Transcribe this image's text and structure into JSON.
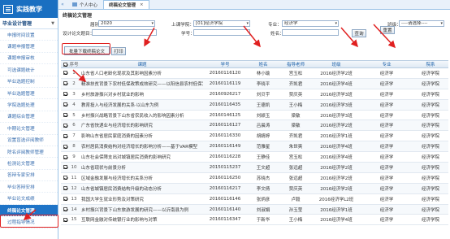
{
  "sidebar": {
    "logo": "实践教学",
    "section": "毕业设计管理",
    "items": [
      {
        "label": "申报时间设置"
      },
      {
        "label": "课题申报管理"
      },
      {
        "label": "课题申报审核"
      },
      {
        "label": "可选课题统计"
      },
      {
        "label": "毕业选题控制"
      },
      {
        "label": "毕业选题管理"
      },
      {
        "label": "学院选题处理"
      },
      {
        "label": "课题综合管理"
      },
      {
        "label": "中期论文管理"
      },
      {
        "label": "设置盲选评阅教师"
      },
      {
        "label": "除名评阅教师管理"
      },
      {
        "label": "检测论文管理"
      },
      {
        "label": "答辩专家安排"
      },
      {
        "label": "毕业答辩安排"
      },
      {
        "label": "毕业论文成绩"
      },
      {
        "label": "终稿论文管理",
        "active": true
      },
      {
        "label": "过程指导情况"
      }
    ]
  },
  "topbar": {
    "tabs": [
      {
        "label": "个人中心"
      },
      {
        "label": "终稿论文管理",
        "active": true
      }
    ]
  },
  "panel": {
    "title": "终稿论文管理",
    "filters": {
      "year_label": "届别：",
      "year_value": "2020",
      "college_label": "上课学院：",
      "college_value": "[01]经济学院",
      "major_label": "专业：",
      "major_value": "经济学",
      "class_label": "班级：",
      "class_value": "----请选择----",
      "title_label": "设计论文题目：",
      "title_value": "",
      "sid_label": "学号：",
      "sid_value": "",
      "name_label": "姓名：",
      "name_value": "",
      "search_btn": "查询",
      "reset_btn": "重置",
      "batch_btn": "批量下载终稿论文",
      "print_btn": "打印"
    }
  },
  "table": {
    "headers": [
      "序号",
      "课题",
      "学号",
      "姓名",
      "指导老师",
      "班级",
      "专业",
      "院系"
    ],
    "rows": [
      {
        "n": "1",
        "title": "山东省人口老龄化现状及其影响因素分析",
        "sid": "20160116120",
        "name": "林小瑜",
        "teacher": "宫玉松",
        "cls": "2016经济学2班",
        "major": "经济学",
        "dept": "经济学院"
      },
      {
        "n": "2",
        "title": "精准扶贫背景下农村低保政策成效研究——以阳信县农村低保为例",
        "sid": "20160116119",
        "name": "李晓平",
        "teacher": "齐凯君",
        "cls": "2016经济学4班",
        "major": "经济学",
        "dept": "经济学院"
      },
      {
        "n": "3",
        "title": "乡村旅游振兴对乡村就业的影响",
        "sid": "20160926217",
        "name": "刘贝宇",
        "teacher": "贾庆英",
        "cls": "2016经济学3班",
        "major": "经济学",
        "dept": "经济学院"
      },
      {
        "n": "4",
        "title": "教育投入与经济发展的关系·以山东为例",
        "sid": "20160116435",
        "name": "王德凯",
        "teacher": "王小梅",
        "cls": "2016经济学3班",
        "major": "经济学",
        "dept": "经济学院"
      },
      {
        "n": "5",
        "title": "乡村振兴战略背景下山东省农民收入的影响因素分析",
        "sid": "20160146125",
        "name": "刘颖玉",
        "teacher": "梁敏",
        "cls": "2016经济学3班",
        "major": "经济学",
        "dept": "经济学院"
      },
      {
        "n": "6",
        "title": "广东省快递业与经济增长的影响研究",
        "sid": "20160116127",
        "name": "吕晨涛",
        "teacher": "梁敏",
        "cls": "2016经济学2班",
        "major": "经济学",
        "dept": "经济学院"
      },
      {
        "n": "7",
        "title": "影响山东省居民家庭消费的因素分析",
        "sid": "20160116330",
        "name": "胡婧婷",
        "teacher": "齐凯君",
        "cls": "2016经济学1班",
        "major": "经济学",
        "dept": "经济学院"
      },
      {
        "n": "8",
        "title": "农村居民消费结构对经济增长的影响分析——基于VAR模型",
        "sid": "20160116149",
        "name": "范雅星",
        "teacher": "朱世爽",
        "cls": "2016经济学4班",
        "major": "经济学",
        "dept": "经济学院"
      },
      {
        "n": "9",
        "title": "山东社会保障支出对城镇居民消费的影响研究",
        "sid": "20160116228",
        "name": "王静佳",
        "teacher": "宫玉松",
        "cls": "2016经济学4班",
        "major": "经济学",
        "dept": "经济学院"
      },
      {
        "n": "10",
        "title": "山东省现状与前景分析",
        "sid": "20150115237",
        "name": "王文超",
        "teacher": "张远超",
        "cls": "2016经济学2班",
        "major": "经济学",
        "dept": "经济学院"
      },
      {
        "n": "11",
        "title": "区域金融发展与经济增长的关系分析",
        "sid": "20160116250",
        "name": "苏晓杰",
        "teacher": "张远超",
        "cls": "2016经济学2班",
        "major": "经济学",
        "dept": "经济学院"
      },
      {
        "n": "12",
        "title": "山东省城镇居民消费结构升级的动态分析",
        "sid": "20160116217",
        "name": "李文倩",
        "teacher": "贾庆英",
        "cls": "2016经济学2班",
        "major": "经济学",
        "dept": "经济学院"
      },
      {
        "n": "13",
        "title": "我国大学生就业形势及对策研究",
        "sid": "20160116146",
        "name": "张炳彦",
        "teacher": "卢毅",
        "cls": "2016经济学L2班",
        "major": "经济学",
        "dept": "经济学院"
      },
      {
        "n": "14",
        "title": "乡村振兴背景下山东旅游发展的研究——以沂南县为例",
        "sid": "20160116140",
        "name": "刘淑娟",
        "teacher": "孙玉莹",
        "cls": "2016经济学1班",
        "major": "经济学",
        "dept": "经济学院"
      },
      {
        "n": "15",
        "title": "互联网金融对传统银行业的影响与对策",
        "sid": "20160116347",
        "name": "于新华",
        "teacher": "王小梅",
        "cls": "2016经济学4班",
        "major": "经济学",
        "dept": "经济学院"
      }
    ]
  }
}
